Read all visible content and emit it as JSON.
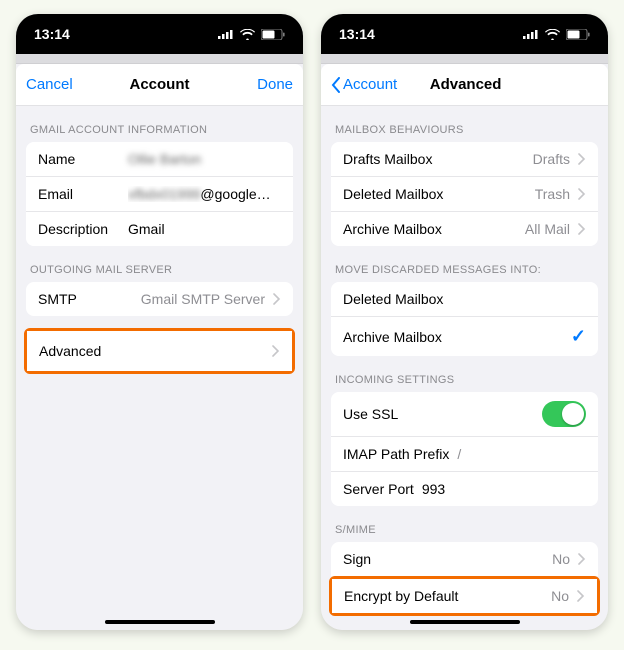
{
  "status": {
    "time": "13:14"
  },
  "left": {
    "nav": {
      "cancel": "Cancel",
      "title": "Account",
      "done": "Done"
    },
    "sections": {
      "info_header": "GMAIL ACCOUNT INFORMATION",
      "name_label": "Name",
      "name_value": "Ollie Barton",
      "email_label": "Email",
      "email_value_hidden": "xfbdx01999",
      "email_value_domain": "@googlemail.com",
      "desc_label": "Description",
      "desc_value": "Gmail",
      "outgoing_header": "OUTGOING MAIL SERVER",
      "smtp_label": "SMTP",
      "smtp_value": "Gmail SMTP Server",
      "advanced_label": "Advanced"
    }
  },
  "right": {
    "nav": {
      "back": "Account",
      "title": "Advanced"
    },
    "sections": {
      "behaviours_header": "MAILBOX BEHAVIOURS",
      "drafts_label": "Drafts Mailbox",
      "drafts_value": "Drafts",
      "deleted_label": "Deleted Mailbox",
      "deleted_value": "Trash",
      "archive_label": "Archive Mailbox",
      "archive_value": "All Mail",
      "discard_header": "MOVE DISCARDED MESSAGES INTO:",
      "discard_deleted": "Deleted Mailbox",
      "discard_archive": "Archive Mailbox",
      "incoming_header": "INCOMING SETTINGS",
      "ssl_label": "Use SSL",
      "imap_label": "IMAP Path Prefix",
      "imap_value": "/",
      "port_label": "Server Port",
      "port_value": "993",
      "smime_header": "S/MIME",
      "sign_label": "Sign",
      "sign_value": "No",
      "encrypt_label": "Encrypt by Default",
      "encrypt_value": "No"
    }
  }
}
